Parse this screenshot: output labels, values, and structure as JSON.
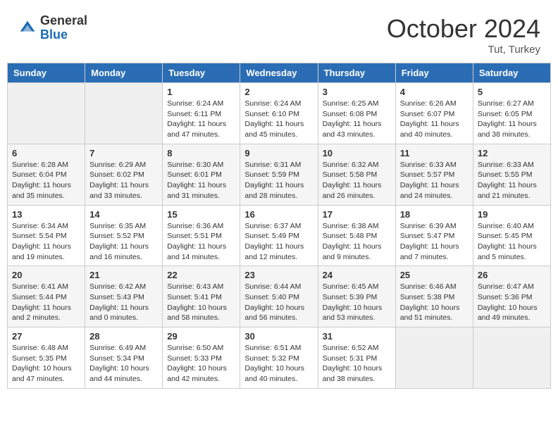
{
  "header": {
    "logo_general": "General",
    "logo_blue": "Blue",
    "month": "October 2024",
    "location": "Tut, Turkey"
  },
  "weekdays": [
    "Sunday",
    "Monday",
    "Tuesday",
    "Wednesday",
    "Thursday",
    "Friday",
    "Saturday"
  ],
  "weeks": [
    [
      {
        "day": "",
        "info": ""
      },
      {
        "day": "",
        "info": ""
      },
      {
        "day": "1",
        "info": "Sunrise: 6:24 AM\nSunset: 6:11 PM\nDaylight: 11 hours and 47 minutes."
      },
      {
        "day": "2",
        "info": "Sunrise: 6:24 AM\nSunset: 6:10 PM\nDaylight: 11 hours and 45 minutes."
      },
      {
        "day": "3",
        "info": "Sunrise: 6:25 AM\nSunset: 6:08 PM\nDaylight: 11 hours and 43 minutes."
      },
      {
        "day": "4",
        "info": "Sunrise: 6:26 AM\nSunset: 6:07 PM\nDaylight: 11 hours and 40 minutes."
      },
      {
        "day": "5",
        "info": "Sunrise: 6:27 AM\nSunset: 6:05 PM\nDaylight: 11 hours and 38 minutes."
      }
    ],
    [
      {
        "day": "6",
        "info": "Sunrise: 6:28 AM\nSunset: 6:04 PM\nDaylight: 11 hours and 35 minutes."
      },
      {
        "day": "7",
        "info": "Sunrise: 6:29 AM\nSunset: 6:02 PM\nDaylight: 11 hours and 33 minutes."
      },
      {
        "day": "8",
        "info": "Sunrise: 6:30 AM\nSunset: 6:01 PM\nDaylight: 11 hours and 31 minutes."
      },
      {
        "day": "9",
        "info": "Sunrise: 6:31 AM\nSunset: 5:59 PM\nDaylight: 11 hours and 28 minutes."
      },
      {
        "day": "10",
        "info": "Sunrise: 6:32 AM\nSunset: 5:58 PM\nDaylight: 11 hours and 26 minutes."
      },
      {
        "day": "11",
        "info": "Sunrise: 6:33 AM\nSunset: 5:57 PM\nDaylight: 11 hours and 24 minutes."
      },
      {
        "day": "12",
        "info": "Sunrise: 6:33 AM\nSunset: 5:55 PM\nDaylight: 11 hours and 21 minutes."
      }
    ],
    [
      {
        "day": "13",
        "info": "Sunrise: 6:34 AM\nSunset: 5:54 PM\nDaylight: 11 hours and 19 minutes."
      },
      {
        "day": "14",
        "info": "Sunrise: 6:35 AM\nSunset: 5:52 PM\nDaylight: 11 hours and 16 minutes."
      },
      {
        "day": "15",
        "info": "Sunrise: 6:36 AM\nSunset: 5:51 PM\nDaylight: 11 hours and 14 minutes."
      },
      {
        "day": "16",
        "info": "Sunrise: 6:37 AM\nSunset: 5:49 PM\nDaylight: 11 hours and 12 minutes."
      },
      {
        "day": "17",
        "info": "Sunrise: 6:38 AM\nSunset: 5:48 PM\nDaylight: 11 hours and 9 minutes."
      },
      {
        "day": "18",
        "info": "Sunrise: 6:39 AM\nSunset: 5:47 PM\nDaylight: 11 hours and 7 minutes."
      },
      {
        "day": "19",
        "info": "Sunrise: 6:40 AM\nSunset: 5:45 PM\nDaylight: 11 hours and 5 minutes."
      }
    ],
    [
      {
        "day": "20",
        "info": "Sunrise: 6:41 AM\nSunset: 5:44 PM\nDaylight: 11 hours and 2 minutes."
      },
      {
        "day": "21",
        "info": "Sunrise: 6:42 AM\nSunset: 5:43 PM\nDaylight: 11 hours and 0 minutes."
      },
      {
        "day": "22",
        "info": "Sunrise: 6:43 AM\nSunset: 5:41 PM\nDaylight: 10 hours and 58 minutes."
      },
      {
        "day": "23",
        "info": "Sunrise: 6:44 AM\nSunset: 5:40 PM\nDaylight: 10 hours and 56 minutes."
      },
      {
        "day": "24",
        "info": "Sunrise: 6:45 AM\nSunset: 5:39 PM\nDaylight: 10 hours and 53 minutes."
      },
      {
        "day": "25",
        "info": "Sunrise: 6:46 AM\nSunset: 5:38 PM\nDaylight: 10 hours and 51 minutes."
      },
      {
        "day": "26",
        "info": "Sunrise: 6:47 AM\nSunset: 5:36 PM\nDaylight: 10 hours and 49 minutes."
      }
    ],
    [
      {
        "day": "27",
        "info": "Sunrise: 6:48 AM\nSunset: 5:35 PM\nDaylight: 10 hours and 47 minutes."
      },
      {
        "day": "28",
        "info": "Sunrise: 6:49 AM\nSunset: 5:34 PM\nDaylight: 10 hours and 44 minutes."
      },
      {
        "day": "29",
        "info": "Sunrise: 6:50 AM\nSunset: 5:33 PM\nDaylight: 10 hours and 42 minutes."
      },
      {
        "day": "30",
        "info": "Sunrise: 6:51 AM\nSunset: 5:32 PM\nDaylight: 10 hours and 40 minutes."
      },
      {
        "day": "31",
        "info": "Sunrise: 6:52 AM\nSunset: 5:31 PM\nDaylight: 10 hours and 38 minutes."
      },
      {
        "day": "",
        "info": ""
      },
      {
        "day": "",
        "info": ""
      }
    ]
  ]
}
